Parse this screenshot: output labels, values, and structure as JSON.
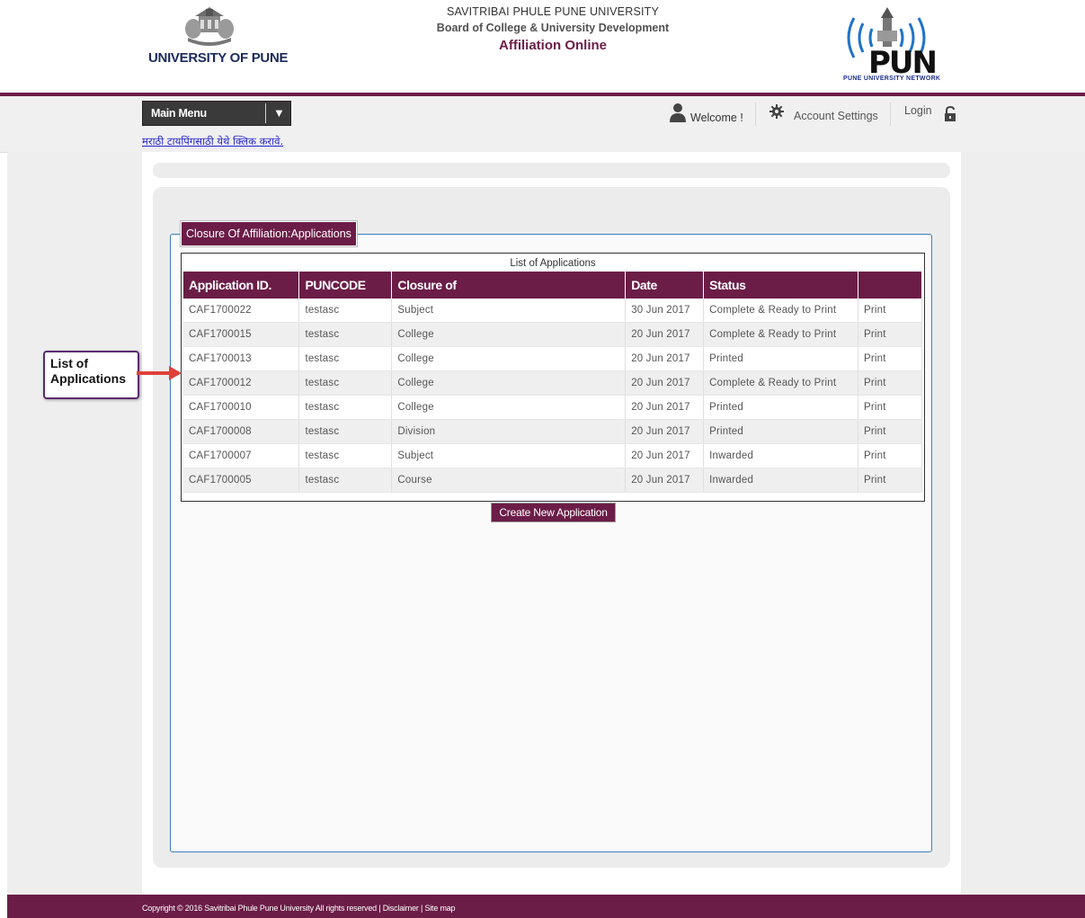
{
  "header": {
    "left_logo_text": "UNIVERSITY OF PUNE",
    "university_name": "SAVITRIBAI PHULE PUNE UNIVERSITY",
    "board_name": "Board of College & University Development",
    "app_title": "Affiliation Online",
    "right_logo_caption": "PUNE UNIVERSITY NETWORK",
    "right_logo_text": "PUN"
  },
  "nav": {
    "main_menu_label": "Main Menu",
    "welcome_label": "Welcome !",
    "account_settings_label": "Account Settings",
    "login_label": "Login",
    "marathi_link": "मराठी टायपिंगसाठी येथे क्लिक करावे."
  },
  "panel": {
    "legend": "Closure Of Affiliation:Applications",
    "table_caption": "List of Applications",
    "columns": [
      "Application ID.",
      "PUNCODE",
      "Closure of",
      "Date",
      "Status",
      ""
    ],
    "rows": [
      {
        "id": "CAF1700022",
        "puncode": "testasc",
        "closure": "Subject",
        "date": "30 Jun 2017",
        "status": "Complete & Ready to Print",
        "action": "Print"
      },
      {
        "id": "CAF1700015",
        "puncode": "testasc",
        "closure": "College",
        "date": "20 Jun 2017",
        "status": "Complete & Ready to Print",
        "action": "Print"
      },
      {
        "id": "CAF1700013",
        "puncode": "testasc",
        "closure": "College",
        "date": "20 Jun 2017",
        "status": "Printed",
        "action": "Print"
      },
      {
        "id": "CAF1700012",
        "puncode": "testasc",
        "closure": "College",
        "date": "20 Jun 2017",
        "status": "Complete & Ready to Print",
        "action": "Print"
      },
      {
        "id": "CAF1700010",
        "puncode": "testasc",
        "closure": "College",
        "date": "20 Jun 2017",
        "status": "Printed",
        "action": "Print"
      },
      {
        "id": "CAF1700008",
        "puncode": "testasc",
        "closure": "Division",
        "date": "20 Jun 2017",
        "status": "Printed",
        "action": "Print"
      },
      {
        "id": "CAF1700007",
        "puncode": "testasc",
        "closure": "Subject",
        "date": "20 Jun 2017",
        "status": "Inwarded",
        "action": "Print"
      },
      {
        "id": "CAF1700005",
        "puncode": "testasc",
        "closure": "Course",
        "date": "20 Jun 2017",
        "status": "Inwarded",
        "action": "Print"
      }
    ],
    "create_button": "Create New Application"
  },
  "annotation": {
    "callout_line1": "List of",
    "callout_line2": "Applications"
  },
  "footer": {
    "text": "Copyright © 2016 Savitribai Phule Pune University All rights reserved | Disclaimer | Site map"
  },
  "colors": {
    "brand": "#6b1d47",
    "annotation_arrow": "#e0403a",
    "annotation_border": "#5a2a6e",
    "fieldset_border": "#3a7fbf"
  },
  "icons": [
    "university-emblem-icon",
    "pun-network-logo",
    "user-icon",
    "gear-icon",
    "lock-icon",
    "dropdown-arrow-icon",
    "annotation-arrow"
  ]
}
